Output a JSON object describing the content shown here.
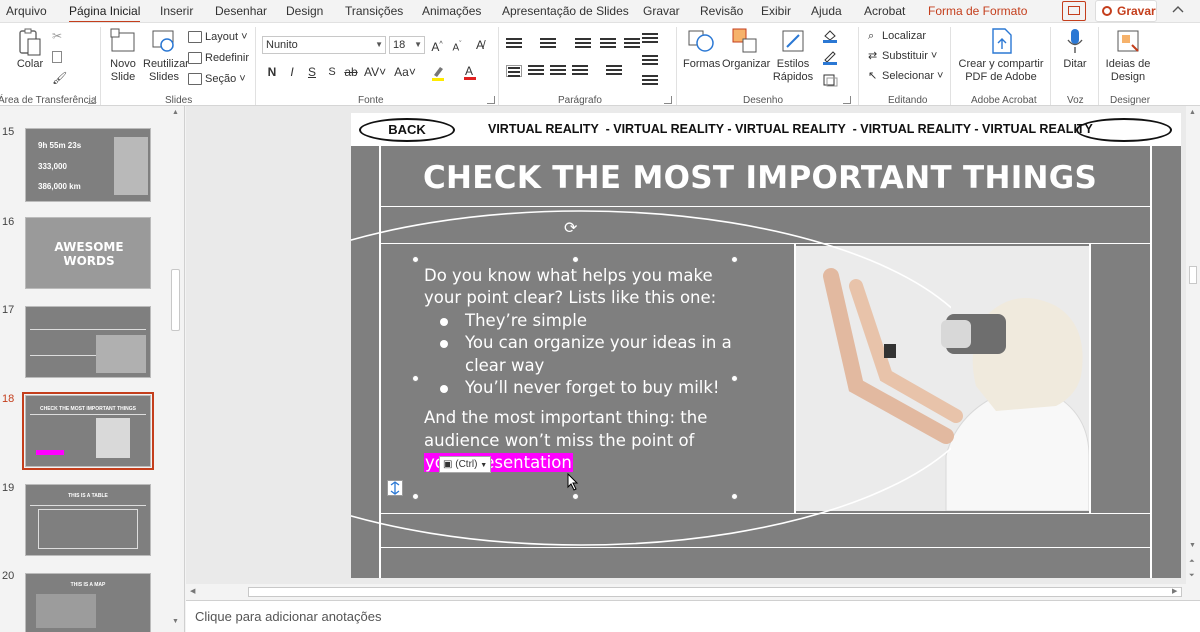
{
  "tabs": [
    "Arquivo",
    "Página Inicial",
    "Inserir",
    "Desenhar",
    "Design",
    "Transições",
    "Animações",
    "Apresentação de Slides",
    "Gravar",
    "Revisão",
    "Exibir",
    "Ajuda",
    "Acrobat",
    "Forma de Formato"
  ],
  "active_tab": "Página Inicial",
  "record_label": "Gravar",
  "ribbon": {
    "clipboard": {
      "paste": "Colar",
      "label": "Área de Transferência"
    },
    "slides": {
      "new_slide": "Novo Slide",
      "new_slide_line1": "Novo",
      "new_slide_line2": "Slide",
      "reuse_line1": "Reutilizar",
      "reuse_line2": "Slides",
      "layout": "Layout",
      "reset": "Redefinir",
      "section": "Seção",
      "label": "Slides"
    },
    "font": {
      "family": "Nunito",
      "size": "18",
      "label": "Fonte"
    },
    "paragraph": {
      "label": "Parágrafo"
    },
    "drawing": {
      "shapes": "Formas",
      "arrange": "Organizar",
      "styles_line1": "Estilos",
      "styles_line2": "Rápidos",
      "label": "Desenho"
    },
    "editing": {
      "find": "Localizar",
      "replace": "Substituir",
      "select": "Selecionar",
      "label": "Editando"
    },
    "acrobat": {
      "line1": "Crear y compartir",
      "line2": "PDF de Adobe",
      "label": "Adobe Acrobat"
    },
    "voice": {
      "dictate": "Ditar",
      "label": "Voz"
    },
    "designer": {
      "line1": "Ideias de",
      "line2": "Design",
      "label": "Designer"
    }
  },
  "slide_numbers": [
    "15",
    "16",
    "17",
    "18",
    "19",
    "20"
  ],
  "selected_slide": "18",
  "thumbs": {
    "t15_a": "9h 55m 23s",
    "t15_b": "333,000",
    "t15_c": "386,000 km",
    "t16": "AWESOME WORDS",
    "t18": "CHECK THE MOST IMPORTANT THINGS",
    "t19": "THIS IS A TABLE",
    "t20": "THIS IS A MAP"
  },
  "slide": {
    "back_label": "BACK",
    "marquee": "VIRTUAL REALITY  - VIRTUAL REALITY - VIRTUAL REALITY  - VIRTUAL REALITY - VIRTUAL REALITY",
    "title": "CHECK THE MOST IMPORTANT THINGS",
    "intro": "Do you know what helps you make your point clear? Lists like this one:",
    "bullets": [
      "They’re simple",
      "You can organize your ideas in a clear way",
      "You’ll never forget to buy milk!"
    ],
    "closing_prefix": "And the most important thing: the audience won’t miss the point of",
    "closing_highlight": "your presentation"
  },
  "paste_tag": "(Ctrl)",
  "notes_placeholder": "Clique para adicionar anotações",
  "colors": {
    "accent": "#c43e1c",
    "highlight": "#ff00ff",
    "slide_bg": "#7f7f7f"
  }
}
